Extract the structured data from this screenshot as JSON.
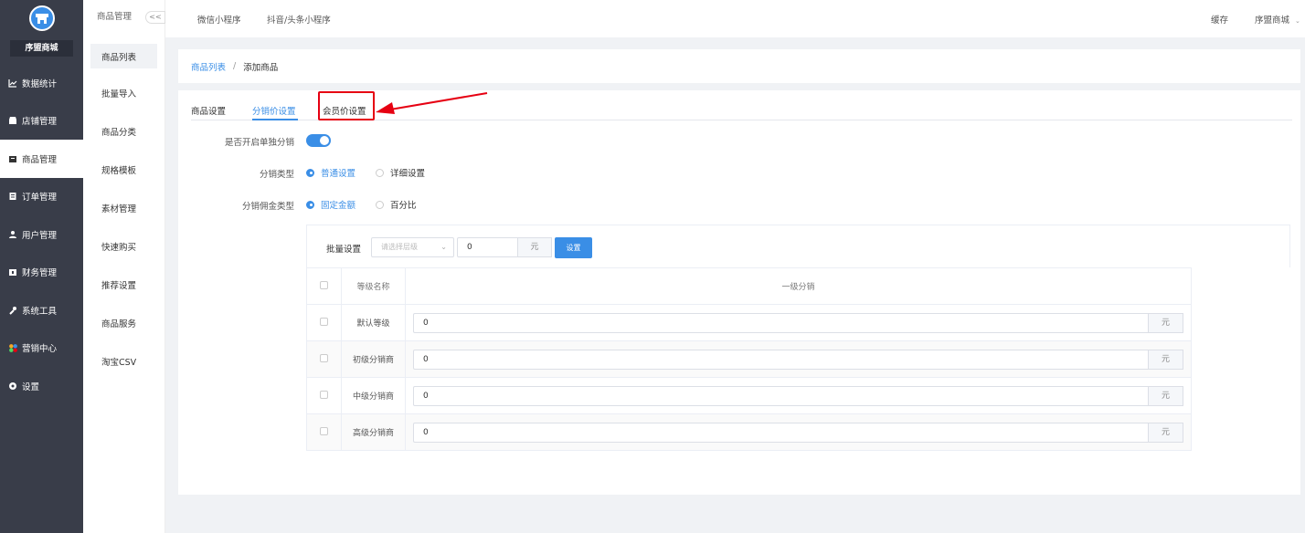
{
  "sidebar": {
    "shop_name": "序盟商城",
    "items": [
      {
        "label": "数据统计",
        "icon": "chart-icon"
      },
      {
        "label": "店铺管理",
        "icon": "store-icon"
      },
      {
        "label": "商品管理",
        "icon": "goods-icon"
      },
      {
        "label": "订单管理",
        "icon": "order-icon"
      },
      {
        "label": "用户管理",
        "icon": "user-icon"
      },
      {
        "label": "财务管理",
        "icon": "finance-icon"
      },
      {
        "label": "系统工具",
        "icon": "wrench-icon"
      },
      {
        "label": "营销中心",
        "icon": "marketing-icon"
      },
      {
        "label": "设置",
        "icon": "gear-icon"
      }
    ]
  },
  "subnav": {
    "title": "商品管理",
    "collapse": "<<",
    "items": [
      "商品列表",
      "批量导入",
      "商品分类",
      "规格模板",
      "素材管理",
      "快速购买",
      "推荐设置",
      "商品服务",
      "淘宝CSV"
    ]
  },
  "topbar": {
    "tabs": [
      "微信小程序",
      "抖音/头条小程序"
    ],
    "cache": "缓存",
    "shop": "序盟商城"
  },
  "breadcrumb": {
    "parent": "商品列表",
    "sep": "/",
    "current": "添加商品"
  },
  "tabs": [
    "商品设置",
    "分销价设置",
    "会员价设置"
  ],
  "form": {
    "standalone_label": "是否开启单独分销",
    "type_label": "分销类型",
    "type_options": [
      "普通设置",
      "详细设置"
    ],
    "commission_label": "分销佣金类型",
    "commission_options": [
      "固定金额",
      "百分比"
    ]
  },
  "batch": {
    "label": "批量设置",
    "select_placeholder": "请选择层级",
    "value": "0",
    "unit": "元",
    "button": "设置"
  },
  "table": {
    "headers": [
      "等级名称",
      "一级分销"
    ],
    "rows": [
      {
        "name": "默认等级",
        "value": "0",
        "unit": "元"
      },
      {
        "name": "初级分销商",
        "value": "0",
        "unit": "元"
      },
      {
        "name": "中级分销商",
        "value": "0",
        "unit": "元"
      },
      {
        "name": "高级分销商",
        "value": "0",
        "unit": "元"
      }
    ]
  },
  "colors": {
    "accent": "#3a8ee6",
    "sidebar": "#393d49",
    "highlight": "#e60012"
  }
}
